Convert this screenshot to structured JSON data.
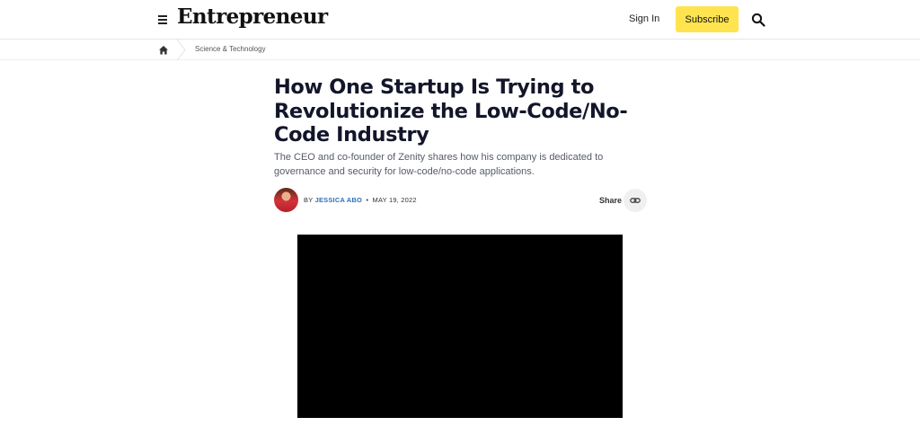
{
  "header": {
    "logo": "Entrepreneur",
    "sign_in": "Sign In",
    "subscribe": "Subscribe",
    "menu_icon": "hamburger-menu-icon",
    "search_icon": "search-icon",
    "subscribe_color": "#ffe34f"
  },
  "breadcrumb": {
    "home_icon": "home-icon",
    "category": "Science & Technology"
  },
  "article": {
    "title": "How One Startup Is Trying to Revolutionize the Low-Code/No-Code Industry",
    "subtitle": "The CEO and co-founder of Zenity shares how his company is dedicated to governance and security for low-code/no-code applications.",
    "by_prefix": "BY",
    "author": "JESSICA ABO",
    "separator": "•",
    "date": "MAY 19, 2022",
    "share_label": "Share",
    "share_icon": "link-icon",
    "author_color": "#2f6fb8"
  }
}
